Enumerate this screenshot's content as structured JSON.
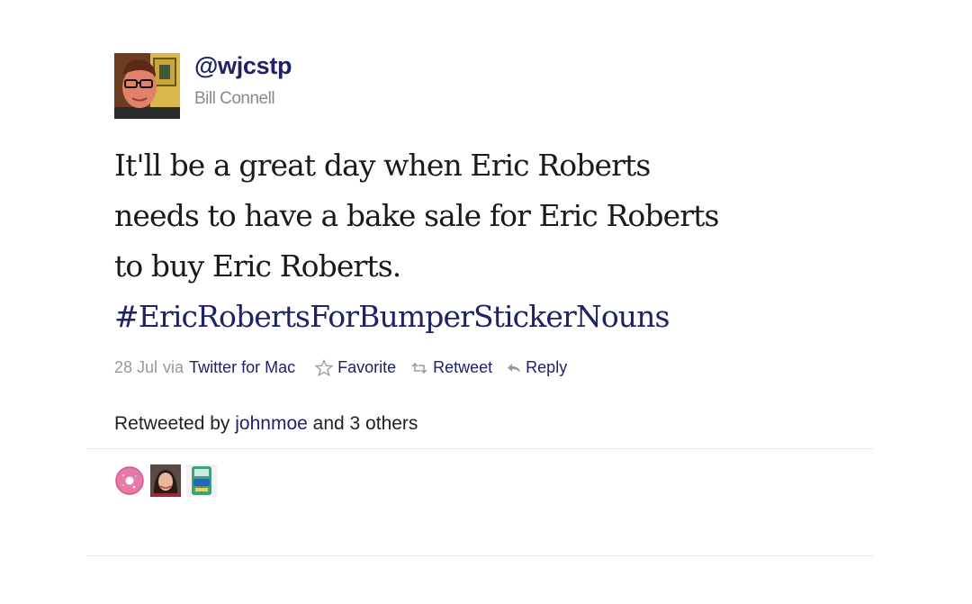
{
  "author": {
    "handle": "@wjcstp",
    "name": "Bill Connell"
  },
  "tweet": {
    "lines": [
      "It'll be a great day when Eric Roberts",
      "needs to have a bake sale for Eric Roberts",
      "to buy Eric Roberts."
    ],
    "hashtag": "#EricRobertsForBumperStickerNouns"
  },
  "meta": {
    "date": "28 Jul",
    "via_label": "via",
    "source": "Twitter for Mac",
    "actions": {
      "favorite": {
        "label": "Favorite",
        "icon": "star-icon"
      },
      "retweet": {
        "label": "Retweet",
        "icon": "retweet-icon"
      },
      "reply": {
        "label": "Reply",
        "icon": "reply-icon"
      }
    }
  },
  "retweets": {
    "prefix": "Retweeted by",
    "user": "johnmoe",
    "suffix": "and 3 others"
  },
  "colors": {
    "link": "#1e2366",
    "muted": "#999999",
    "text": "#1a1a1a"
  }
}
